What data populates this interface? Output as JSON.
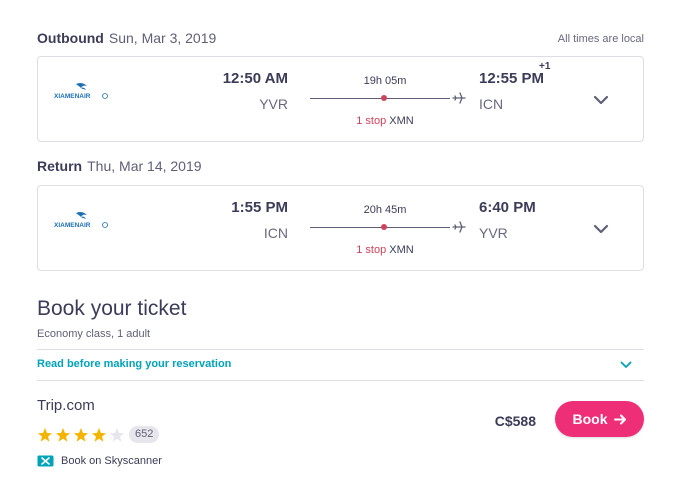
{
  "outbound": {
    "label": "Outbound",
    "date": "Sun, Mar 3, 2019",
    "times_note": "All times are local",
    "airline": "XIAMENAIR",
    "dep_time": "12:50 AM",
    "dep_code": "YVR",
    "arr_time": "12:55 PM",
    "arr_plus": "+1",
    "arr_code": "ICN",
    "duration": "19h 05m",
    "stops": "1 stop",
    "via": "XMN"
  },
  "return": {
    "label": "Return",
    "date": "Thu, Mar 14, 2019",
    "airline": "XIAMENAIR",
    "dep_time": "1:55 PM",
    "dep_code": "ICN",
    "arr_time": "6:40 PM",
    "arr_code": "YVR",
    "duration": "20h 45m",
    "stops": "1 stop",
    "via": "XMN"
  },
  "booking": {
    "title": "Book your ticket",
    "subtitle": "Economy class, 1 adult",
    "read_link": "Read before making your reservation",
    "provider": "Trip.com",
    "rating": 4,
    "rating_max": 5,
    "review_count": "652",
    "skyscanner_label": "Book on Skyscanner",
    "price": "C$588",
    "book_label": "Book"
  },
  "colors": {
    "accent": "#ef2e78",
    "link": "#00a3b8",
    "stop_red": "#d1435b",
    "star": "#f5b400",
    "airline_blue": "#1d6fb5"
  }
}
